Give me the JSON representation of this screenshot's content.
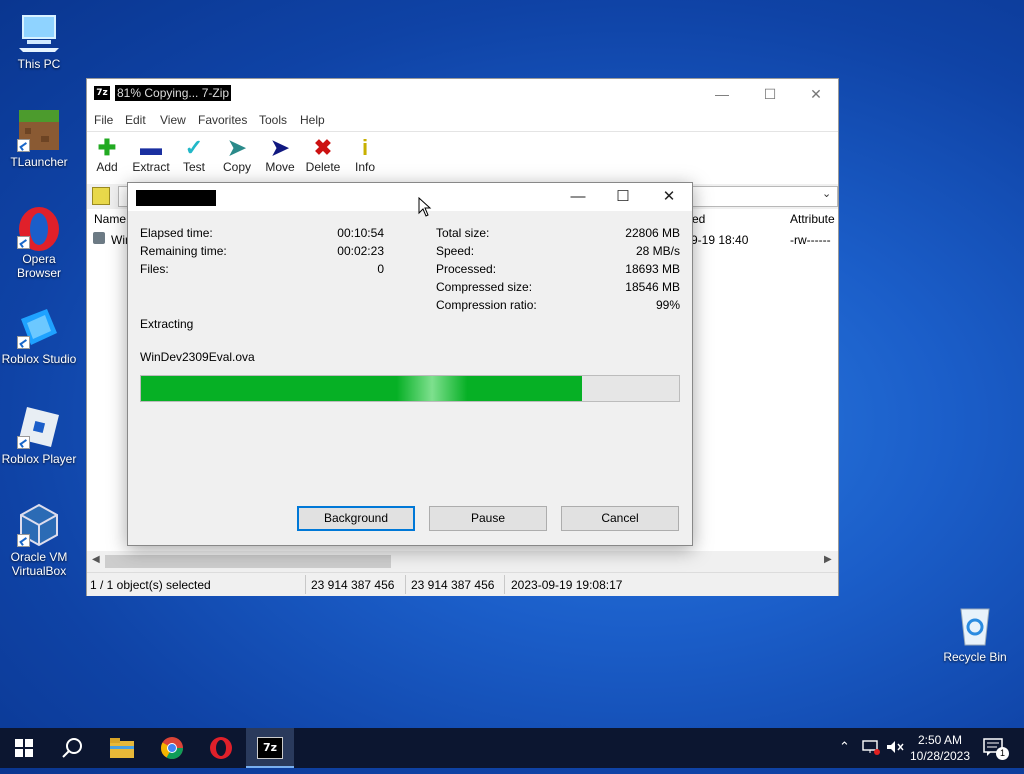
{
  "desktop": {
    "icons": [
      {
        "label": "This PC",
        "icon": "computer-icon"
      },
      {
        "label": "TLauncher",
        "icon": "grass-block-icon"
      },
      {
        "label": "Opera Browser",
        "icon": "opera-icon"
      },
      {
        "label": "Roblox Studio",
        "icon": "roblox-studio-icon"
      },
      {
        "label": "Roblox Player",
        "icon": "roblox-player-icon"
      },
      {
        "label": "Oracle VM VirtualBox",
        "icon": "virtualbox-icon"
      },
      {
        "label": "Recycle Bin",
        "icon": "recycle-bin-icon"
      }
    ]
  },
  "main_window": {
    "title": "81% Copying... 7-Zip",
    "menu": [
      "File",
      "Edit",
      "View",
      "Favorites",
      "Tools",
      "Help"
    ],
    "toolbar": [
      {
        "label": "Add",
        "icon": "plus-icon",
        "color": "#22aa22"
      },
      {
        "label": "Extract",
        "icon": "minus-icon",
        "color": "#1a2fa0"
      },
      {
        "label": "Test",
        "icon": "check-icon",
        "color": "#22b8c8"
      },
      {
        "label": "Copy",
        "icon": "arrow-copy-icon",
        "color": "#2a8a8a"
      },
      {
        "label": "Move",
        "icon": "arrow-move-icon",
        "color": "#101880"
      },
      {
        "label": "Delete",
        "icon": "x-icon",
        "color": "#cc1111"
      },
      {
        "label": "Info",
        "icon": "info-icon",
        "color": "#c8b000"
      }
    ],
    "columns": [
      "Name",
      "ed",
      "Attribute"
    ],
    "row": {
      "name": "Win",
      "modified": "9-19 18:40",
      "attributes": "-rw------"
    },
    "status": {
      "selection": "1 / 1 object(s) selected",
      "size": "23 914 387 456",
      "packed": "23 914 387 456",
      "modified": "2023-09-19 19:08:17"
    }
  },
  "progress_dialog": {
    "left": [
      {
        "label": "Elapsed time:",
        "value": "00:10:54"
      },
      {
        "label": "Remaining time:",
        "value": "00:02:23"
      },
      {
        "label": "Files:",
        "value": "0"
      }
    ],
    "right": [
      {
        "label": "Total size:",
        "value": "22806 MB"
      },
      {
        "label": "Speed:",
        "value": "28 MB/s"
      },
      {
        "label": "Processed:",
        "value": "18693 MB"
      },
      {
        "label": "Compressed size:",
        "value": "18546 MB"
      },
      {
        "label": "Compression ratio:",
        "value": "99%"
      }
    ],
    "operation": "Extracting",
    "file": "WinDev2309Eval.ova",
    "progress": 0.82,
    "buttons": {
      "background": "Background",
      "pause": "Pause",
      "cancel": "Cancel"
    }
  },
  "taskbar": {
    "apps": [
      "start-icon",
      "search-icon",
      "file-explorer-icon",
      "chrome-icon",
      "opera-icon",
      "7zip-icon"
    ],
    "time": "2:50 AM",
    "date": "10/28/2023",
    "notification_count": "1"
  }
}
